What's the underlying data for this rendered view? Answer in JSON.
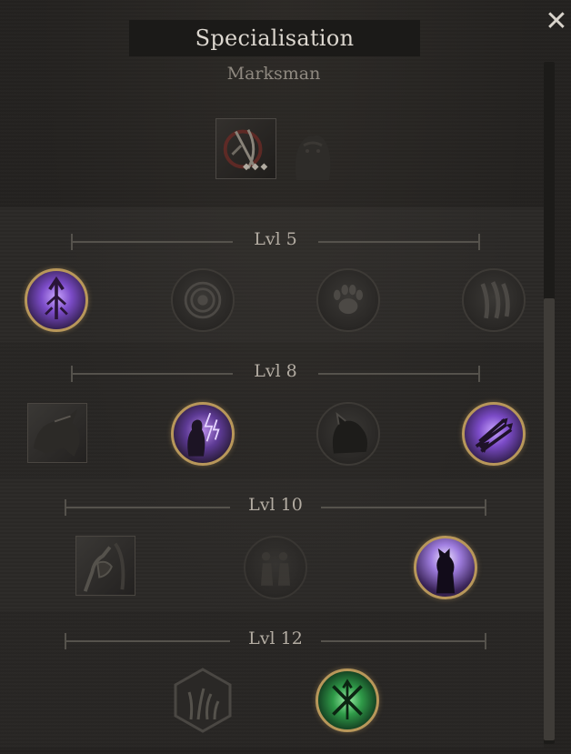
{
  "header": {
    "title": "Specialisation",
    "close_glyph": "✕"
  },
  "specialisation": {
    "name": "Marksman",
    "icons": [
      "marksman-bow-icon",
      "beast-companion-icon"
    ]
  },
  "tiers": [
    {
      "label": "Lvl 5",
      "nodes": [
        {
          "icon": "arrow-burst-icon",
          "state": "selected"
        },
        {
          "icon": "target-rings-icon",
          "state": "locked"
        },
        {
          "icon": "paw-print-icon",
          "state": "locked"
        },
        {
          "icon": "claw-slash-icon",
          "state": "locked"
        }
      ]
    },
    {
      "label": "Lvl 8",
      "nodes": [
        {
          "icon": "charging-beast-icon",
          "state": "locked"
        },
        {
          "icon": "lightning-figure-icon",
          "state": "selected"
        },
        {
          "icon": "wolf-head-icon",
          "state": "locked"
        },
        {
          "icon": "arrow-volley-icon",
          "state": "selected"
        }
      ]
    },
    {
      "label": "Lvl 10",
      "nodes": [
        {
          "icon": "armored-arm-icon",
          "state": "locked"
        },
        {
          "icon": "pack-silhouette-icon",
          "state": "locked"
        },
        {
          "icon": "howling-wolf-icon",
          "state": "selected"
        }
      ]
    },
    {
      "label": "Lvl 12",
      "nodes": [
        {
          "icon": "tall-grass-icon",
          "state": "locked"
        },
        {
          "icon": "crossed-blades-icon",
          "state": "selected"
        }
      ]
    }
  ],
  "colors": {
    "selected_border": "#b8975a",
    "selected_glow_purple": "#7b4bc7",
    "selected_glow_green": "#2f9a48"
  }
}
